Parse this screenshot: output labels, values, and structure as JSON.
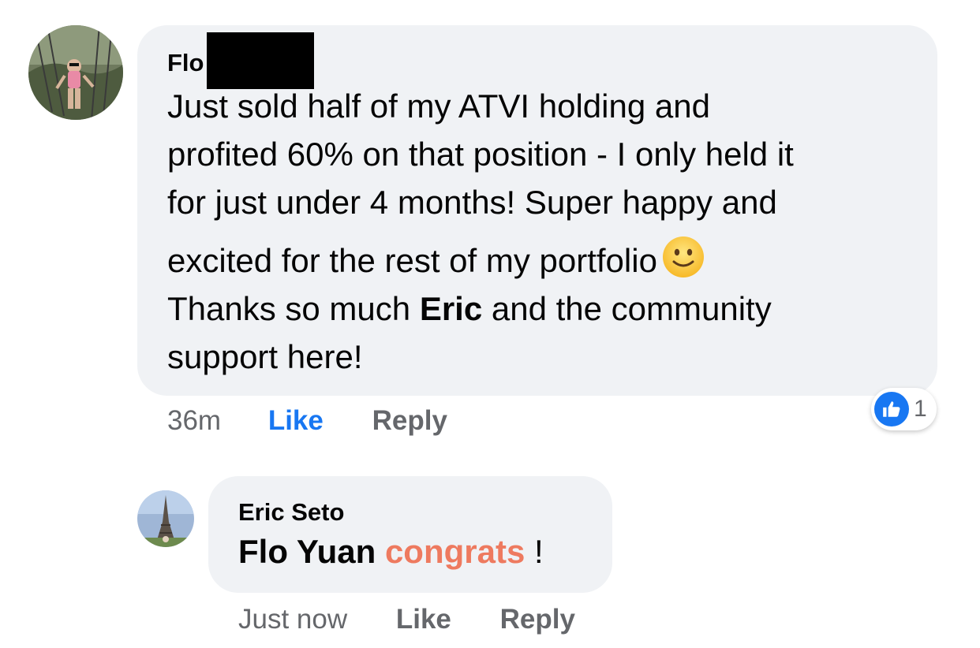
{
  "comment": {
    "author": "Flo",
    "text_lines": [
      "Just sold half of my ATVI holding and",
      "profited 60% on that position - I only held it",
      "for just under 4 months! Super happy and",
      "excited for the rest of my portfolio"
    ],
    "thanks_prefix": "Thanks so much ",
    "thanks_mention": "Eric",
    "thanks_suffix": " and the community",
    "last_line": "support here!",
    "emoji": "slightly-smiling-face",
    "time": "36m",
    "like_label": "Like",
    "reply_label": "Reply",
    "reaction_icon": "thumbs-up-icon",
    "reaction_count": "1"
  },
  "reply": {
    "author": "Eric Seto",
    "mention": "Flo Yuan",
    "text": "congrats",
    "suffix": " !",
    "time": "Just now",
    "like_label": "Like",
    "reply_label": "Reply"
  },
  "colors": {
    "bubble": "#f0f2f5",
    "like_active": "#1877f2",
    "muted": "#65676b",
    "congrats": "#ee7a5f"
  }
}
